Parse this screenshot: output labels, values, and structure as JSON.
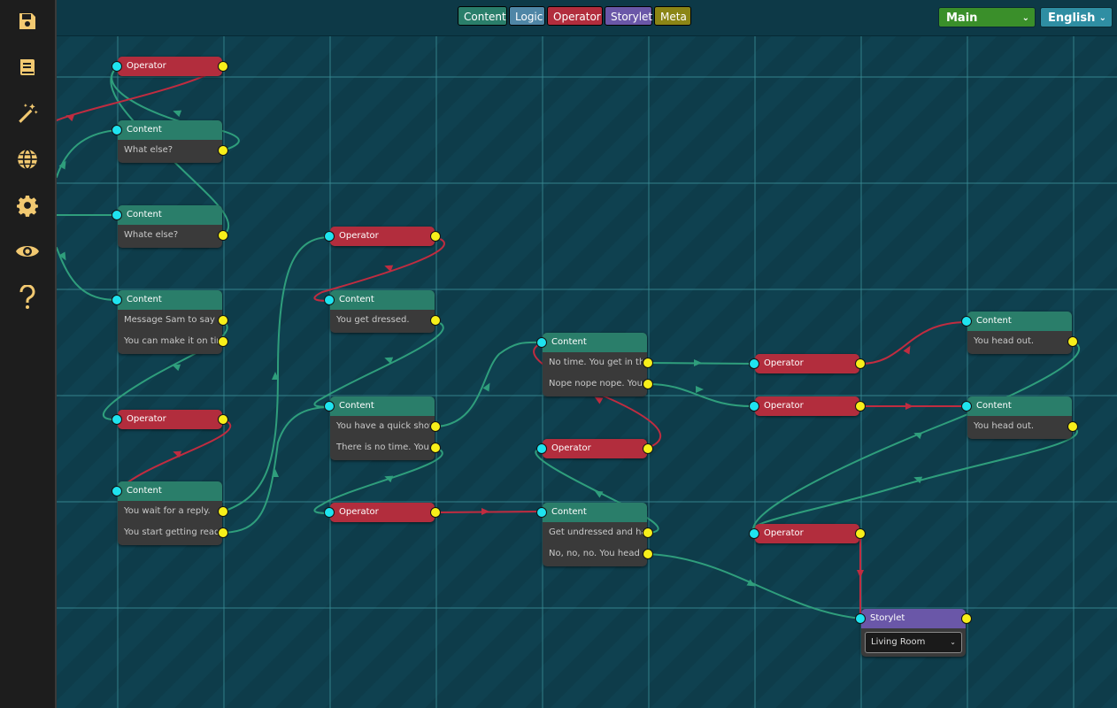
{
  "topbar": {
    "categories": [
      {
        "label": "Content",
        "color": "#2a7e6a"
      },
      {
        "label": "Logic",
        "color": "#4f86a6"
      },
      {
        "label": "Operator",
        "color": "#b22d3d"
      },
      {
        "label": "Storylet",
        "color": "#6a57a8"
      },
      {
        "label": "Meta",
        "color": "#8b8516"
      }
    ],
    "branch_select": "Main",
    "language_select": "English"
  },
  "sidebar": {
    "icons": [
      "save-icon",
      "book-icon",
      "magic-wand-icon",
      "globe-icon",
      "gear-icon",
      "eye-icon",
      "help-icon"
    ]
  },
  "nodes": {
    "n1": {
      "title": "Operator"
    },
    "n2": {
      "title": "Content",
      "rows": [
        "What else?"
      ]
    },
    "n3": {
      "title": "Content",
      "rows": [
        "Whate else?"
      ]
    },
    "n4": {
      "title": "Content",
      "rows": [
        "Message Sam to say you",
        "You can make it on time"
      ]
    },
    "n5": {
      "title": "Operator"
    },
    "n6": {
      "title": "Content",
      "rows": [
        "You wait for a reply.",
        "You start getting ready."
      ]
    },
    "n7": {
      "title": "Operator"
    },
    "n8": {
      "title": "Content",
      "rows": [
        "You get dressed."
      ]
    },
    "n9": {
      "title": "Content",
      "rows": [
        "You have a quick shower",
        "There is no time. You wi"
      ]
    },
    "n10": {
      "title": "Operator"
    },
    "n11": {
      "title": "Content",
      "rows": [
        "No time. You get in the",
        "Nope nope nope. You a"
      ]
    },
    "n12": {
      "title": "Operator"
    },
    "n13": {
      "title": "Content",
      "rows": [
        "Get undressed and hav",
        "No, no, no. You head ou"
      ]
    },
    "n14": {
      "title": "Operator"
    },
    "n15": {
      "title": "Operator"
    },
    "n16": {
      "title": "Operator"
    },
    "n17": {
      "title": "Content",
      "rows": [
        "You head out."
      ]
    },
    "n18": {
      "title": "Content",
      "rows": [
        "You head out."
      ]
    },
    "n19": {
      "title": "Storylet",
      "dropdown": "Living Room"
    }
  },
  "colors": {
    "content": "#2a7e6a",
    "operator": "#b22d3d",
    "storylet": "#6a57a8",
    "wire_green": "#2f9e7c",
    "wire_red": "#c02c40",
    "port_in": "#1fe3ef",
    "port_out": "#f7ef1a",
    "sidebar_icon": "#f2c971"
  }
}
